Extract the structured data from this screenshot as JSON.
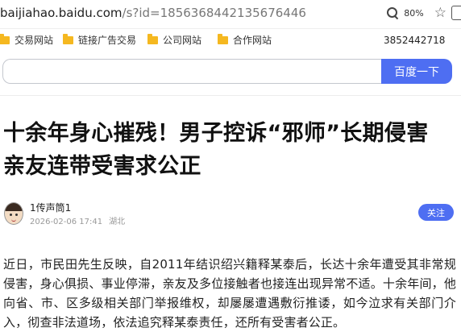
{
  "address_bar": {
    "url_host": "baijiahao.baidu.com",
    "url_path": "/s?id=1856368442135676446",
    "zoom": "80%",
    "zoom_icon": "zoom-in-icon",
    "bookmark_icon": "star-icon"
  },
  "bookmarks": {
    "items": [
      {
        "label": "交易网站",
        "icon": "folder-icon"
      },
      {
        "label": "链接广告交易",
        "icon": "folder-icon"
      },
      {
        "label": "公司网站",
        "icon": "folder-icon"
      },
      {
        "label": "合作网站",
        "icon": "folder-icon"
      }
    ],
    "number": "3852442718"
  },
  "search": {
    "value": "",
    "button_label": "百度一下"
  },
  "article": {
    "title": "十余年身心摧残！男子控诉“邪师”长期侵害 亲友连带受害求公正",
    "author": {
      "name": "1传声筒1",
      "datetime": "2026-02-06 17:41",
      "location": "湖北",
      "follow_label": "关注"
    },
    "body": "近日，市民田先生反映，自2011年结识绍兴籍释某泰后，长达十余年遭受其非常规侵害，身心俱损、事业停滞，亲友及多位接触者也接连出现异常不适。十余年间，他向省、市、区多级相关部门举报维权，却屡屡遭遇敷衍推诿，如今泣求有关部门介入，彻查非法道场，依法追究释某泰责任，还所有受害者公正。"
  },
  "colors": {
    "accent": "#4e6ef2",
    "folder": "#f5b820"
  }
}
